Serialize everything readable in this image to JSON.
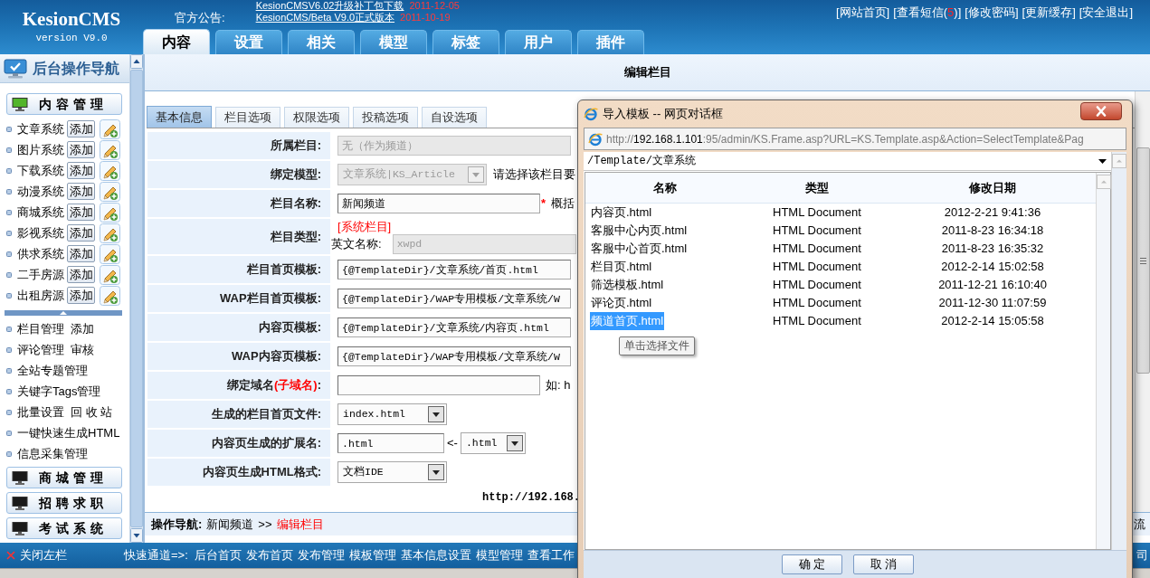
{
  "header": {
    "logo": "KesionCMS",
    "version": "version V9.0",
    "notice_label": "官方公告:",
    "notices": [
      {
        "title": "KesionCMSV6.02升级补丁包下载",
        "date": "2011-12-05"
      },
      {
        "title": "KesionCMS/Beta V9.0正式版本",
        "date": "2011-10-19"
      }
    ],
    "links": [
      {
        "label": "[网站首页]"
      },
      {
        "label": "[查看短信(",
        "count": "5",
        "label_after": ")]"
      },
      {
        "label": "[修改密码]"
      },
      {
        "label": "[更新缓存]"
      },
      {
        "label": "[安全退出]"
      }
    ]
  },
  "nav_tabs": [
    {
      "label": "内容",
      "selected": true
    },
    {
      "label": "设置",
      "selected": false
    },
    {
      "label": "相关",
      "selected": false
    },
    {
      "label": "模型",
      "selected": false
    },
    {
      "label": "标签",
      "selected": false
    },
    {
      "label": "用户",
      "selected": false
    },
    {
      "label": "插件",
      "selected": false
    }
  ],
  "sidebar": {
    "title": "后台操作导航",
    "groups": [
      {
        "label": "内容管理",
        "expanded": true,
        "modules": [
          {
            "name": "文章系统",
            "action": "添加"
          },
          {
            "name": "图片系统",
            "action": "添加"
          },
          {
            "name": "下载系统",
            "action": "添加"
          },
          {
            "name": "动漫系统",
            "action": "添加"
          },
          {
            "name": "商城系统",
            "action": "添加"
          },
          {
            "name": "影视系统",
            "action": "添加"
          },
          {
            "name": "供求系统",
            "action": "添加"
          },
          {
            "name": "二手房源",
            "action": "添加"
          },
          {
            "name": "出租房源",
            "action": "添加"
          }
        ],
        "links": [
          {
            "parts": [
              "栏目管理",
              "添加"
            ]
          },
          {
            "parts": [
              "评论管理",
              "审核"
            ]
          },
          {
            "parts": [
              "全站专题管理"
            ]
          },
          {
            "parts": [
              "关键字Tags管理"
            ]
          },
          {
            "parts": [
              "批量设置",
              "回 收 站"
            ]
          },
          {
            "parts": [
              "一键快速生成HTML"
            ]
          },
          {
            "parts": [
              "信息采集管理"
            ]
          }
        ]
      },
      {
        "label": "商城管理",
        "expanded": false
      },
      {
        "label": "招聘求职",
        "expanded": false
      },
      {
        "label": "考试系统",
        "expanded": false
      }
    ]
  },
  "page_title": "编辑栏目",
  "form_tabs": [
    {
      "label": "基本信息",
      "selected": true
    },
    {
      "label": "栏目选项",
      "selected": false
    },
    {
      "label": "权限选项",
      "selected": false
    },
    {
      "label": "投稿选项",
      "selected": false
    },
    {
      "label": "自设选项",
      "selected": false
    }
  ],
  "form": [
    {
      "kind": "input",
      "label": "所属栏目:",
      "value": "无（作为频道）",
      "disabled": true
    },
    {
      "kind": "select",
      "label": "绑定模型:",
      "value": "文章系统|KS_Article",
      "disabled": true,
      "note": "请选择该栏目要"
    },
    {
      "kind": "input",
      "label": "栏目名称:",
      "value": "新闻频道",
      "disabled": false,
      "required_mark": "*",
      "note": "概括"
    },
    {
      "kind": "type",
      "label": "栏目类型:",
      "tag": "[系统栏目]",
      "sublabel": "英文名称:",
      "value": "xwpd",
      "disabled": true
    },
    {
      "kind": "input",
      "label": "栏目首页模板:",
      "value": "{@TemplateDir}/文章系统/首页.html",
      "disabled": false
    },
    {
      "kind": "input",
      "label": "WAP栏目首页模板:",
      "value": "{@TemplateDir}/WAP专用模板/文章系统/W",
      "disabled": false
    },
    {
      "kind": "input",
      "label": "内容页模板:",
      "value": "{@TemplateDir}/文章系统/内容页.html",
      "disabled": false
    },
    {
      "kind": "input",
      "label": "WAP内容页模板:",
      "value": "{@TemplateDir}/WAP专用模板/文章系统/W",
      "disabled": false
    },
    {
      "kind": "input",
      "label": "绑定域名",
      "label_highlight": "(子域名)",
      "label_end": ":",
      "disabled": false,
      "note": "如: h"
    },
    {
      "kind": "select",
      "label": "生成的栏目首页文件:",
      "value": "index.html",
      "disabled": false
    },
    {
      "kind": "input_select",
      "label": "内容页生成的扩展名:",
      "value": ".html",
      "disabled": false,
      "arrow": "<-",
      "option": ".html"
    },
    {
      "kind": "select",
      "label": "内容页生成HTML格式:",
      "value": "文档IDE",
      "disabled": false
    }
  ],
  "footer_url": "http://192.168.",
  "breadcrumb": {
    "label": "操作导航:",
    "path": "新闻频道",
    "separator": ">>",
    "current": "编辑栏目",
    "edge_text": "流"
  },
  "bottom_bar": {
    "close_label": "关闭左栏",
    "quick_label": "快速通道=>:",
    "links": [
      "后台首页",
      "发布首页",
      "发布管理",
      "模板管理",
      "基本信息设置",
      "模型管理",
      "查看工作"
    ],
    "edge_text": "司"
  },
  "dialog": {
    "title": "导入模板 -- 网页对话框",
    "address": {
      "scheme": "http://",
      "host": "192.168.1.101",
      "path": ":95/admin/KS.Frame.asp?URL=KS.Template.asp&Action=SelectTemplate&Pag"
    },
    "folder": "/Template/文章系统",
    "columns": [
      "名称",
      "类型",
      "修改日期"
    ],
    "files": [
      {
        "name": "内容页.html",
        "type": "HTML Document",
        "modified": "2012-2-21 9:41:36",
        "selected": false
      },
      {
        "name": "客服中心内页.html",
        "type": "HTML Document",
        "modified": "2011-8-23 16:34:18",
        "selected": false
      },
      {
        "name": "客服中心首页.html",
        "type": "HTML Document",
        "modified": "2011-8-23 16:35:32",
        "selected": false
      },
      {
        "name": "栏目页.html",
        "type": "HTML Document",
        "modified": "2012-2-14 15:02:58",
        "selected": false
      },
      {
        "name": "筛选模板.html",
        "type": "HTML Document",
        "modified": "2011-12-21 16:10:40",
        "selected": false
      },
      {
        "name": "评论页.html",
        "type": "HTML Document",
        "modified": "2011-12-30 11:07:59",
        "selected": false
      },
      {
        "name": "频道首页.html",
        "type": "HTML Document",
        "modified": "2012-2-14 15:05:58",
        "selected": true
      }
    ],
    "tooltip": "单击选择文件",
    "buttons": [
      "确 定",
      "取 消"
    ]
  }
}
